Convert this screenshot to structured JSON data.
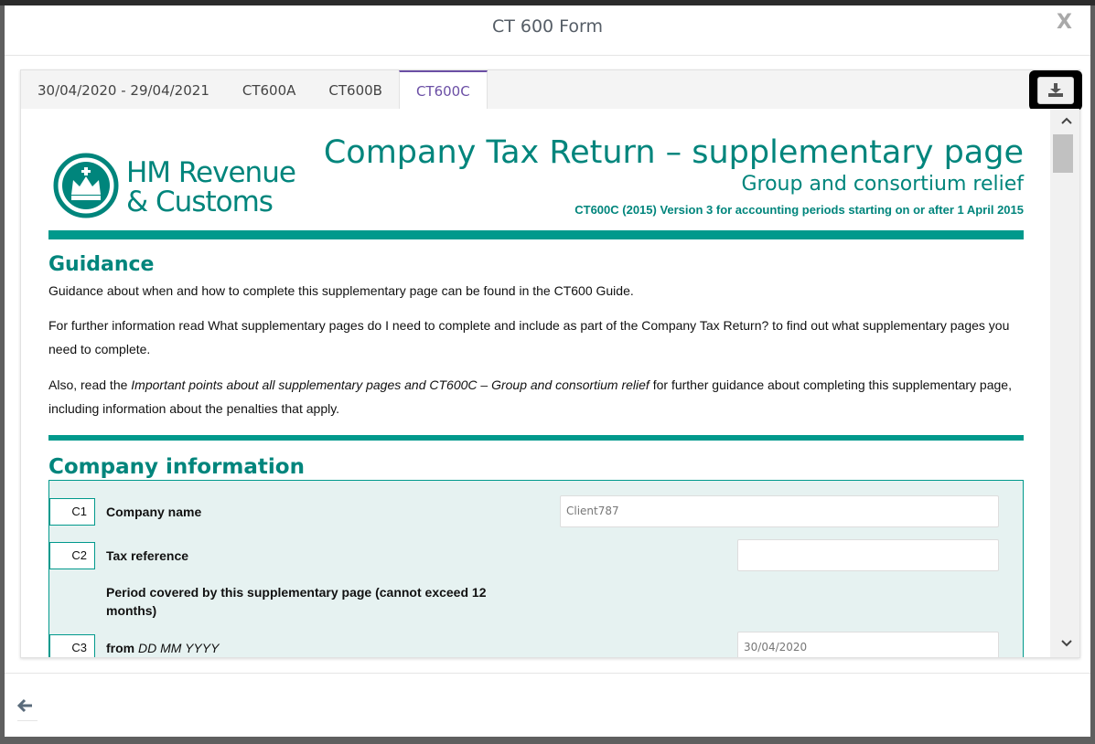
{
  "modal": {
    "title": "CT 600 Form",
    "close_label": "X"
  },
  "tabs": [
    {
      "label": "30/04/2020 - 29/04/2021",
      "active": false
    },
    {
      "label": "CT600A",
      "active": false
    },
    {
      "label": "CT600B",
      "active": false
    },
    {
      "label": "CT600C",
      "active": true
    }
  ],
  "logo": {
    "line1": "HM Revenue",
    "line2": "& Customs"
  },
  "form": {
    "title": "Company Tax Return – supplementary page",
    "subtitle": "Group and consortium relief",
    "version": "CT600C (2015) Version 3 for accounting periods starting on or after 1 April 2015"
  },
  "guidance": {
    "heading": "Guidance",
    "p1": "Guidance about when and how to complete this supplementary page can be found in the CT600 Guide.",
    "p2": "For further information read What supplementary pages do I need to complete and include as part of the Company Tax Return? to find out what supplementary pages you need to complete.",
    "p3_a": "Also, read the ",
    "p3_italic": "Important points about all supplementary pages and CT600C – Group and consortium relief",
    "p3_b": " for further guidance about completing this supplementary page, including information about the penalties that apply."
  },
  "company_info": {
    "heading": "Company information",
    "c1": {
      "code": "C1",
      "label": "Company name",
      "value": "Client787"
    },
    "c2": {
      "code": "C2",
      "label": "Tax reference",
      "value": ""
    },
    "period_label": "Period covered by this supplementary page (cannot exceed 12 months)",
    "c3": {
      "code": "C3",
      "label": "from",
      "label_italic": "DD MM YYYY",
      "value": "30/04/2020"
    }
  },
  "colors": {
    "accent": "#00857c",
    "tab_active": "#6b4fa5"
  },
  "icons": {
    "download": "download-icon",
    "back": "arrow-left-icon",
    "scroll_up": "chevron-up-icon",
    "scroll_down": "chevron-down-icon"
  }
}
